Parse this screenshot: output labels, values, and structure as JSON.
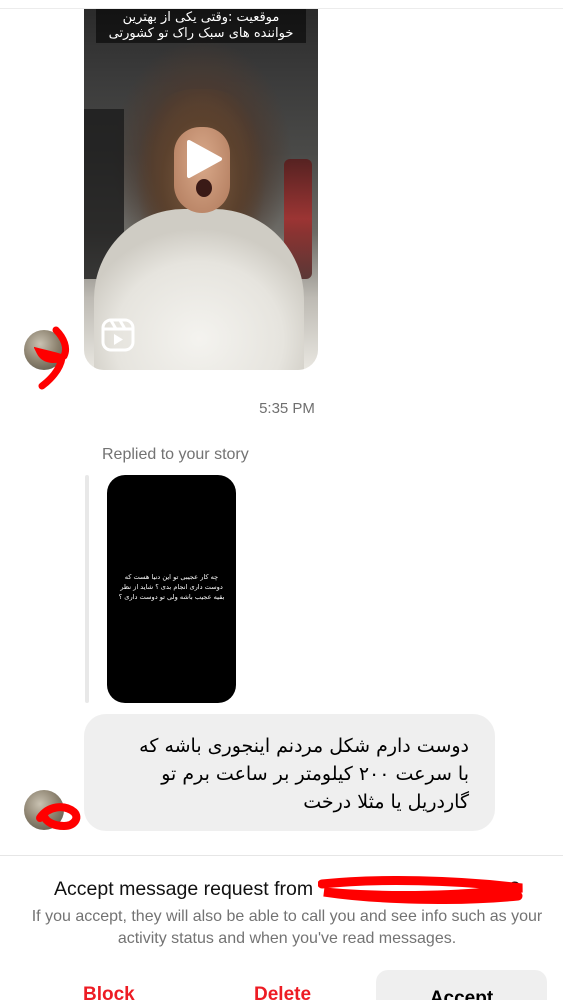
{
  "conversation": {
    "reel": {
      "caption_line1": "موقعیت :وقتی یکی از بهترین",
      "caption_line2": "خواننده های سبک راک تو کشورتی",
      "play_icon": "play-icon",
      "type_icon": "reels-icon"
    },
    "timestamp": "5:35 PM",
    "story_reply": {
      "label": "Replied to your story",
      "story_text": "چه کار عجیبی تو این دنیا هست که دوست داری انجام بدی ؟ شاید از نظر بقیه عجیب باشه ولی تو دوست داری ؟"
    },
    "message": {
      "text": "دوست دارم شکل مردنم اینجوری باشه که\nبا سرعت ۲۰۰ کیلومتر بر ساعت برم تو\nگاردریل یا مثلا درخت"
    }
  },
  "request": {
    "title": "Accept message request from",
    "title_suffix": "?",
    "description": "If you accept, they will also be able to call you and see info such as your activity status and when you've read messages."
  },
  "actions": {
    "block_label": "Block",
    "delete_label": "Delete",
    "accept_label": "Accept"
  },
  "colors": {
    "danger": "#ed1c24",
    "bubble": "#efefef",
    "muted_text": "#737373",
    "redaction": "#ff0000"
  }
}
